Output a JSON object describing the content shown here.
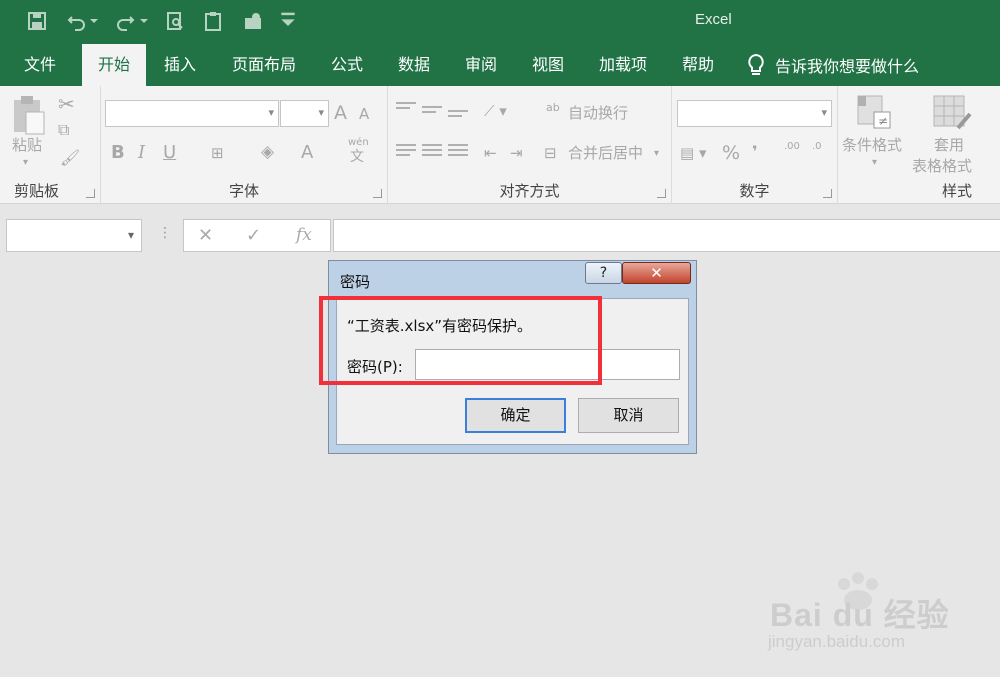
{
  "titlebar": {
    "app_title": "Excel",
    "qat_icons": [
      "save-icon",
      "undo-icon",
      "redo-icon",
      "print-preview-icon",
      "clipboard-icon",
      "email-icon",
      "customize-icon"
    ]
  },
  "tabs": [
    {
      "label": "文件"
    },
    {
      "label": "开始",
      "active": true
    },
    {
      "label": "插入"
    },
    {
      "label": "页面布局"
    },
    {
      "label": "公式"
    },
    {
      "label": "数据"
    },
    {
      "label": "审阅"
    },
    {
      "label": "视图"
    },
    {
      "label": "加载项"
    },
    {
      "label": "帮助"
    }
  ],
  "tellme": {
    "label": "告诉我你想要做什么"
  },
  "ribbon": {
    "clipboard": {
      "label": "剪贴板",
      "paste": "粘贴"
    },
    "font": {
      "label": "字体",
      "bold": "B",
      "italic": "I",
      "underline": "U",
      "grow": "A",
      "shrink": "A",
      "wen": "wén",
      "wen_char": "文"
    },
    "alignment": {
      "label": "对齐方式",
      "wrap": "自动换行",
      "merge": "合并后居中",
      "ab": "ab"
    },
    "number": {
      "label": "数字",
      "percent": "%",
      "comma": "❜",
      "inc": ".00",
      "dec": ".0"
    },
    "styles": {
      "label": "样式",
      "conditional": "条件格式",
      "table_1": "套用",
      "table_2": "表格格式"
    }
  },
  "formula_bar": {
    "fx": "fx"
  },
  "dialog": {
    "title": "密码",
    "help": "?",
    "close": "✕",
    "message": "“工资表.xlsx”有密码保护。",
    "password_label": "密码(P):",
    "password_value": "",
    "ok": "确定",
    "cancel": "取消"
  },
  "watermark": {
    "brand": "Bai du 经验",
    "url": "jingyan.baidu.com"
  },
  "colors": {
    "excel_green": "#217346",
    "highlight_red": "#f2303a"
  }
}
